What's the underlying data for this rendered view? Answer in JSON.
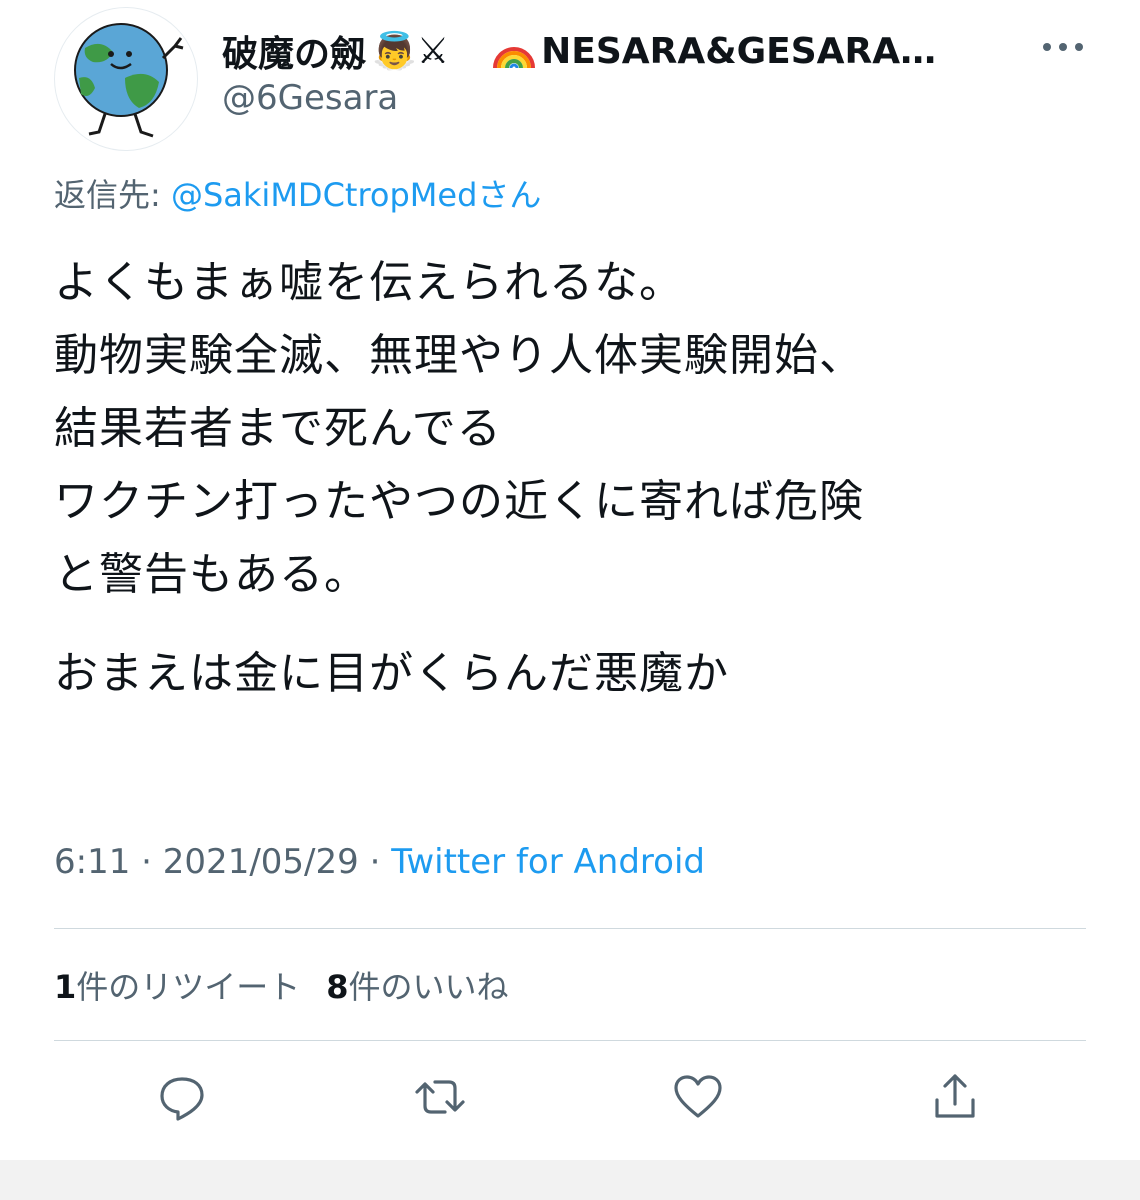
{
  "user": {
    "display_name": "破魔の劔",
    "display_name_emoji": "👼⚔",
    "display_name_extra": "NESARA&GESARA…",
    "handle": "@6Gesara"
  },
  "reply": {
    "prefix": "返信先: ",
    "mention": "@SakiMDCtropMedさん"
  },
  "tweet": {
    "lines": [
      "よくもまぁ嘘を伝えられるな。",
      "動物実験全滅、無理やり人体実験開始、",
      "結果若者まで死んでる",
      "ワクチン打ったやつの近くに寄れば危険",
      "と警告もある。"
    ],
    "closing_line": "おまえは金に目がくらんだ悪魔か"
  },
  "meta": {
    "time": "6:11",
    "sep1": " · ",
    "date": "2021/05/29",
    "sep2": " · ",
    "source": "Twitter for Android"
  },
  "stats": {
    "retweet_count": "1",
    "retweet_label": "件のリツイート",
    "like_count": "8",
    "like_label": "件のいいね"
  },
  "icons": {
    "more": "more-dots-icon",
    "reply": "reply-bubble-icon",
    "retweet": "retweet-icon",
    "like": "heart-icon",
    "share": "share-icon",
    "rainbow": "rainbow-icon",
    "avatar": "globe-character-avatar"
  },
  "colors": {
    "accent": "#1d9bf0",
    "secondary_text": "#536471",
    "primary_text": "#0f1419",
    "icon": "#536471"
  }
}
